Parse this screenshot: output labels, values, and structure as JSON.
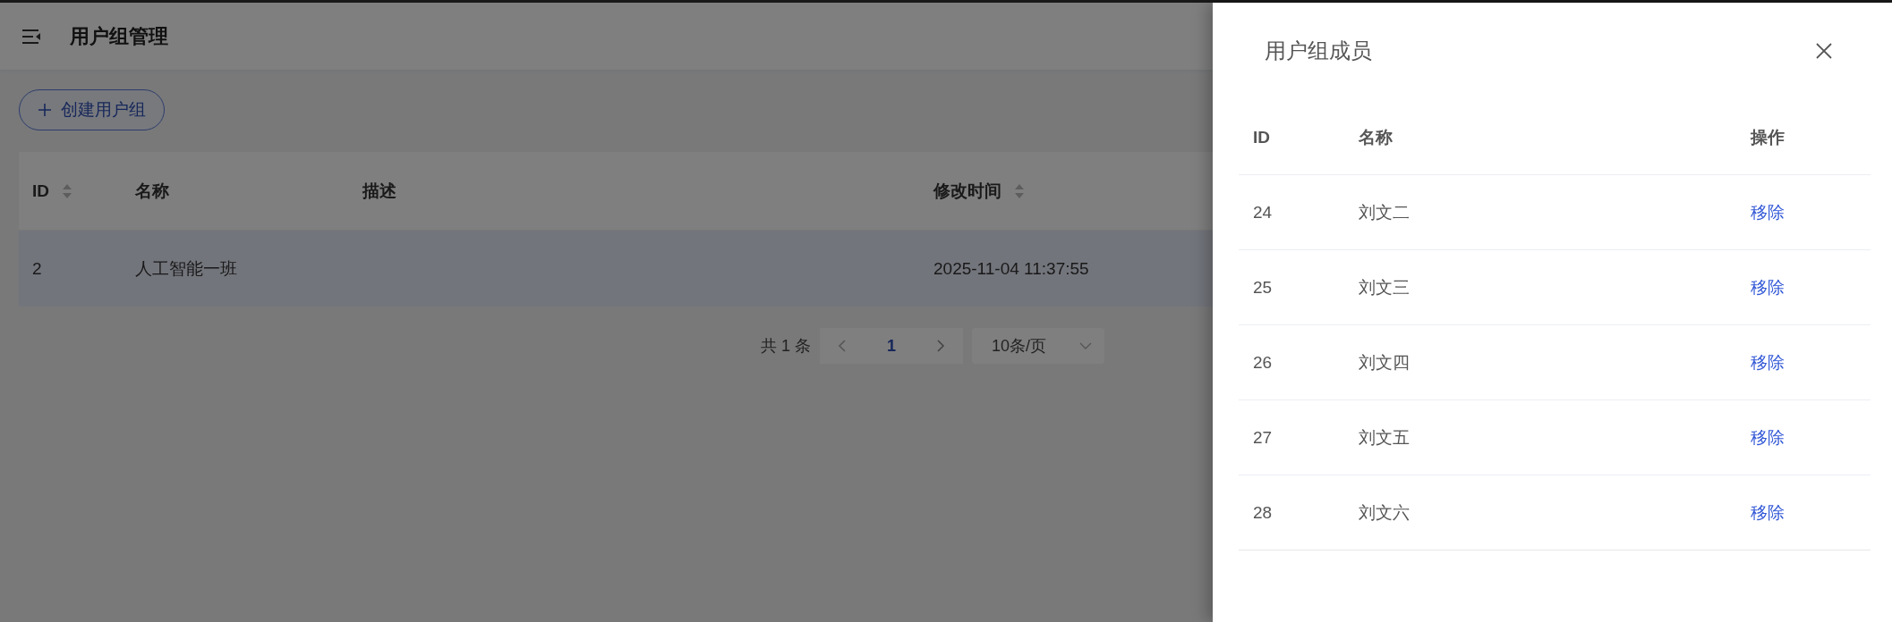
{
  "header": {
    "title": "用户组管理"
  },
  "toolbar": {
    "create_button": "创建用户组"
  },
  "table": {
    "columns": [
      {
        "label": "ID",
        "sortable": true
      },
      {
        "label": "名称",
        "sortable": false
      },
      {
        "label": "描述",
        "sortable": false
      },
      {
        "label": "修改时间",
        "sortable": true
      }
    ],
    "rows": [
      {
        "id": "2",
        "name": "人工智能一班",
        "modified": "2025-11-04 11:37:55",
        "selected": true
      }
    ]
  },
  "pagination": {
    "total": "共 1 条",
    "pages": [
      {
        "label": "1",
        "selected": true
      }
    ],
    "page_size": "10条/页"
  },
  "drawer": {
    "title": "用户组成员",
    "columns": [
      "ID",
      "名称",
      "操作"
    ],
    "rows": [
      {
        "id": "24",
        "name": "刘文二",
        "action": "移除"
      },
      {
        "id": "25",
        "name": "刘文三",
        "action": "移除"
      },
      {
        "id": "26",
        "name": "刘文四",
        "action": "移除"
      },
      {
        "id": "27",
        "name": "刘文五",
        "action": "移除"
      },
      {
        "id": "28",
        "name": "刘文六",
        "action": "移除"
      }
    ]
  }
}
